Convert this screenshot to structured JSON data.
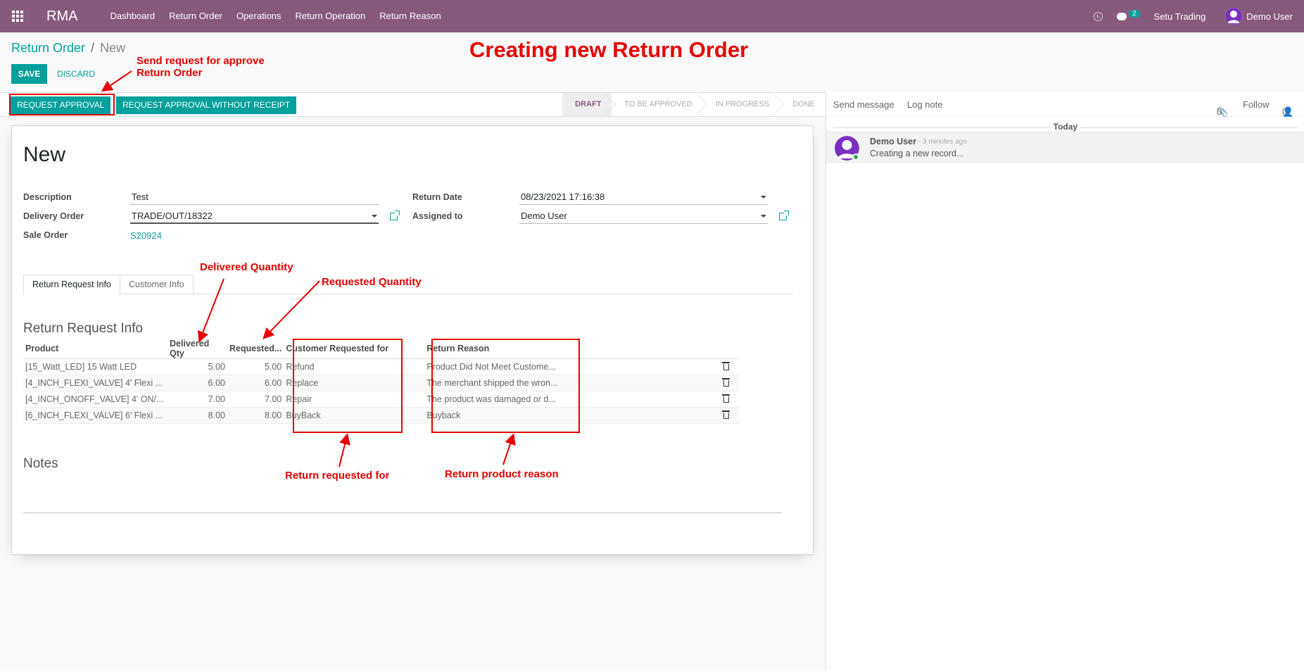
{
  "navbar": {
    "app_name": "RMA",
    "menu": [
      "Dashboard",
      "Return Order",
      "Operations",
      "Return Operation",
      "Return Reason"
    ],
    "message_count": "2",
    "company": "Setu Trading",
    "user": "Demo User"
  },
  "breadcrumb": {
    "parent": "Return Order",
    "separator": "/",
    "current": "New"
  },
  "buttons": {
    "save": "SAVE",
    "discard": "DISCARD",
    "request_approval": "REQUEST APPROVAL",
    "request_approval_without_receipt": "REQUEST APPROVAL WITHOUT RECEIPT"
  },
  "stages": [
    "DRAFT",
    "TO BE APPROVED",
    "IN PROGRESS",
    "DONE"
  ],
  "form": {
    "title": "New",
    "description_label": "Description",
    "description_value": "Test",
    "delivery_order_label": "Delivery Order",
    "delivery_order_value": "TRADE/OUT/18322",
    "sale_order_label": "Sale Order",
    "sale_order_value": "S20924",
    "return_date_label": "Return Date",
    "return_date_value": "08/23/2021 17:16:38",
    "assigned_to_label": "Assigned to",
    "assigned_to_value": "Demo User"
  },
  "tabs": [
    "Return Request Info",
    "Customer Info"
  ],
  "section_title": "Return Request Info",
  "table": {
    "headers": [
      "Product",
      "Delivered Qty",
      "Requested...",
      "Customer Requested for",
      "Return Reason"
    ],
    "rows": [
      {
        "product": "[15_Watt_LED] 15 Watt LED",
        "delivered": "5.00",
        "requested": "5.00",
        "customer_requested_for": "Refund",
        "reason": "Product Did Not Meet Custome..."
      },
      {
        "product": "[4_INCH_FLEXI_VALVE] 4' Flexi ...",
        "delivered": "6.00",
        "requested": "6.00",
        "customer_requested_for": "Replace",
        "reason": "The merchant shipped the wron..."
      },
      {
        "product": "[4_INCH_ONOFF_VALVE] 4' ON/...",
        "delivered": "7.00",
        "requested": "7.00",
        "customer_requested_for": "Repair",
        "reason": "The product was damaged or d..."
      },
      {
        "product": "[6_INCH_FLEXI_VALVE] 6' Flexi ...",
        "delivered": "8.00",
        "requested": "8.00",
        "customer_requested_for": "BuyBack",
        "reason": "Buyback"
      }
    ]
  },
  "notes_title": "Notes",
  "chatter": {
    "send_message": "Send message",
    "log_note": "Log note",
    "attachments": "0",
    "follow": "Follow",
    "followers": "0",
    "today": "Today",
    "message_author": "Demo User",
    "message_time": "- 3 minutes ago",
    "message_body": "Creating a new record..."
  },
  "annotations": {
    "title": "Creating new Return Order",
    "send_request_line1": "Send request for approve",
    "send_request_line2": "Return Order",
    "delivered_quantity": "Delivered Quantity",
    "requested_quantity": "Requested Quantity",
    "return_requested_for": "Return requested for",
    "return_product_reason": "Return product reason"
  },
  "colors": {
    "brand": "#875a7b",
    "primary": "#00a09d",
    "annotation": "#e60000"
  }
}
